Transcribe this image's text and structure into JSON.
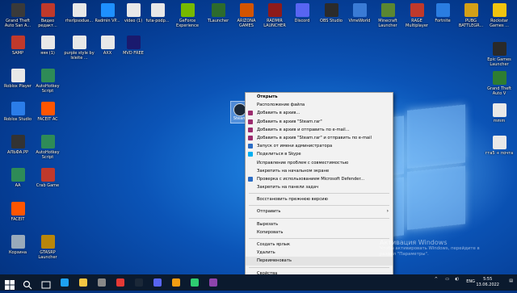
{
  "desktop": {
    "top_row": [
      {
        "label": "Grand Theft Auto San A...",
        "icon": "gta-sa-icon",
        "color": "#3a3a3a"
      },
      {
        "label": "Видео редакт...",
        "icon": "video-editor-icon",
        "color": "#c0392b"
      },
      {
        "label": "rhsrlpsodue...",
        "icon": "file-icon",
        "color": "#e8e8e8"
      },
      {
        "label": "Radmin VP...",
        "icon": "radmin-icon",
        "color": "#1e90ff"
      },
      {
        "label": "video (1)",
        "icon": "video-file-icon",
        "color": "#e8e8e8"
      },
      {
        "label": "futa-podp...",
        "icon": "file-icon",
        "color": "#e8e8e8"
      },
      {
        "label": "GeForce Experience",
        "icon": "geforce-icon",
        "color": "#76b900"
      },
      {
        "label": "TLauncher",
        "icon": "tlauncher-icon",
        "color": "#2d6b2d"
      },
      {
        "label": "ARIZONA GAMES",
        "icon": "arizona-icon",
        "color": "#d35400"
      },
      {
        "label": "RADMIR LAUNCHER",
        "icon": "radmir-icon",
        "color": "#8e1b1b"
      },
      {
        "label": "Discord",
        "icon": "discord-icon",
        "color": "#5865f2"
      },
      {
        "label": "OBS Studio",
        "icon": "obs-icon",
        "color": "#2b2b2b"
      },
      {
        "label": "VimeWorld",
        "icon": "vimeworld-icon",
        "color": "#3a7bd5"
      },
      {
        "label": "Minecraft Launcher",
        "icon": "minecraft-icon",
        "color": "#5b8731"
      },
      {
        "label": "RAGE Multiplayer",
        "icon": "rage-icon",
        "color": "#c0392b"
      },
      {
        "label": "Fortnite",
        "icon": "fortnite-icon",
        "color": "#2a7de1"
      },
      {
        "label": "PUBG BATTLEGR...",
        "icon": "pubg-icon",
        "color": "#d4a017"
      },
      {
        "label": "Rockstar Games ...",
        "icon": "rockstar-icon",
        "color": "#f1c40f"
      }
    ],
    "second_row": [
      {
        "label": "SAMP",
        "icon": "samp-icon",
        "color": "#c0392b"
      },
      {
        "label": "яяя (1)",
        "icon": "file-icon",
        "color": "#e8e8e8"
      },
      {
        "label": "purple style by Isleite ...",
        "icon": "file-icon",
        "color": "#e8e8e8"
      },
      {
        "label": "AXX",
        "icon": "file-icon",
        "color": "#e8e8e8"
      },
      {
        "label": "MVD FREE",
        "icon": "mvd-icon",
        "color": "#1a1a6e"
      }
    ],
    "left_column": [
      {
        "label": "Roblox Player",
        "icon": "roblox-icon",
        "color": "#e8e8e8"
      },
      {
        "label": "AutoHotkey Script",
        "icon": "autohotkey-icon",
        "color": "#2e8b57"
      },
      {
        "label": "Roblox Studio",
        "icon": "roblox-studio-icon",
        "color": "#2b7de9"
      },
      {
        "label": "FACEIT AC",
        "icon": "faceit-icon",
        "color": "#ff5500"
      },
      {
        "label": "АЛЬФА.PP",
        "icon": "app-icon",
        "color": "#333"
      },
      {
        "label": "AutoHotkey Script",
        "icon": "autohotkey-icon",
        "color": "#2e8b57"
      },
      {
        "label": "АА",
        "icon": "app-icon",
        "color": "#2e8b57"
      },
      {
        "label": "Crab Game",
        "icon": "crab-game-icon",
        "color": "#c0392b"
      },
      {
        "label": "FACEIT",
        "icon": "faceit-icon",
        "color": "#ff5500"
      },
      {
        "label": "Корзина",
        "icon": "recycle-bin-icon",
        "color": "#9ab"
      },
      {
        "label": "GTASRP Launcher",
        "icon": "gtasrp-icon",
        "color": "#b8860b"
      }
    ],
    "right_column": [
      {
        "label": "Epic Games Launcher",
        "icon": "epic-games-icon",
        "color": "#2a2a2a"
      },
      {
        "label": "Grand Theft Auto V",
        "icon": "gta5-icon",
        "color": "#2e7d32"
      },
      {
        "label": "mmm",
        "icon": "file-icon",
        "color": "#e8e8e8"
      },
      {
        "label": "гта5 + почта",
        "icon": "file-icon",
        "color": "#e8e8e8"
      }
    ],
    "selected_icon": {
      "label": "Steam",
      "icon": "steam-icon"
    }
  },
  "context_menu": {
    "items": [
      {
        "label": "Открыть",
        "bold": true,
        "icon": ""
      },
      {
        "label": "Расположение файла",
        "icon": ""
      },
      {
        "label": "Добавить в архив...",
        "icon": "winrar-icon"
      },
      {
        "label": "Добавить в архив \"Steam.rar\"",
        "icon": "winrar-icon"
      },
      {
        "label": "Добавить в архив и отправить по e-mail...",
        "icon": "winrar-icon"
      },
      {
        "label": "Добавить в архив \"Steam.rar\" и отправить по e-mail",
        "icon": "winrar-icon"
      },
      {
        "label": "Запуск от имени администратора",
        "icon": "shield-icon"
      },
      {
        "label": "Поделиться в Skype",
        "icon": "skype-icon"
      },
      {
        "label": "Исправление проблем с совместимостью",
        "icon": ""
      },
      {
        "label": "Закрепить на начальном экране",
        "icon": ""
      },
      {
        "label": "Проверка с использованием Microsoft Defender...",
        "icon": "defender-icon"
      },
      {
        "label": "Закрепить на панели задач",
        "icon": ""
      },
      {
        "sep": true
      },
      {
        "label": "Восстановить прежнюю версию",
        "icon": ""
      },
      {
        "sep": true
      },
      {
        "label": "Отправить",
        "icon": "",
        "submenu": true
      },
      {
        "sep": true
      },
      {
        "label": "Вырезать",
        "icon": ""
      },
      {
        "label": "Копировать",
        "icon": ""
      },
      {
        "sep": true
      },
      {
        "label": "Создать ярлык",
        "icon": ""
      },
      {
        "label": "Удалить",
        "icon": ""
      },
      {
        "label": "Переименовать",
        "icon": "",
        "hover": true
      },
      {
        "sep": true
      },
      {
        "label": "Свойства",
        "icon": ""
      }
    ],
    "submenu_arrow": "›"
  },
  "watermark": {
    "title": "Активация Windows",
    "line1": "Чтобы активировать Windows, перейдите в",
    "line2": "раздел \"Параметры\"."
  },
  "taskbar": {
    "start_icon": "windows-start-icon",
    "lang": "ENG",
    "time": "5:55",
    "date": "13.06.2022",
    "pinned": [
      {
        "icon": "search-icon",
        "color": "#ffffff"
      },
      {
        "icon": "task-view-icon",
        "color": "#ffffff"
      },
      {
        "icon": "edge-icon",
        "color": "#1da1f2"
      },
      {
        "icon": "file-explorer-icon",
        "color": "#f4c542"
      },
      {
        "icon": "calculator-icon",
        "color": "#888888"
      },
      {
        "icon": "chrome-icon",
        "color": "#e53935"
      },
      {
        "icon": "steam-task-icon",
        "color": "#1b2838"
      },
      {
        "icon": "discord-task-icon",
        "color": "#5865f2"
      },
      {
        "icon": "app-task-icon",
        "color": "#f39c12"
      },
      {
        "icon": "app-task-icon",
        "color": "#2ecc71"
      },
      {
        "icon": "app-task-icon",
        "color": "#8e44ad"
      }
    ],
    "tray_icons": [
      "chevron-up-icon",
      "network-icon",
      "volume-icon"
    ],
    "notification_icon": "notification-icon"
  }
}
